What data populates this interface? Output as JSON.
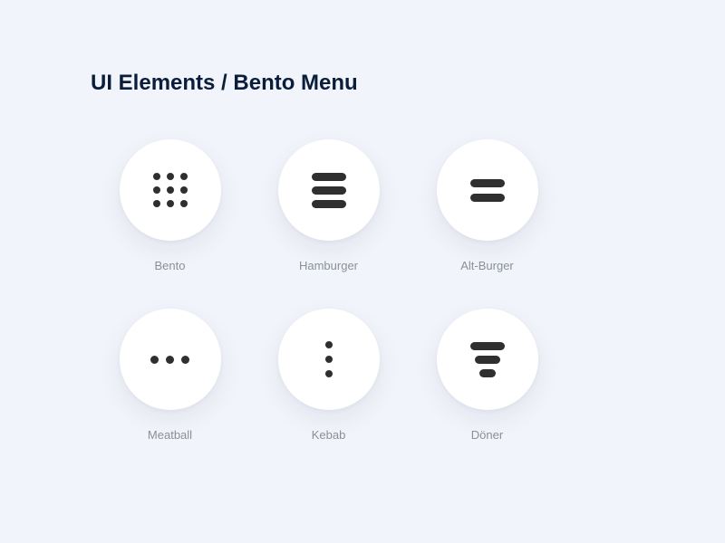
{
  "title": "UI Elements / Bento Menu",
  "items": [
    {
      "label": "Bento"
    },
    {
      "label": "Hamburger"
    },
    {
      "label": "Alt-Burger"
    },
    {
      "label": "Meatball"
    },
    {
      "label": "Kebab"
    },
    {
      "label": "Döner"
    }
  ]
}
